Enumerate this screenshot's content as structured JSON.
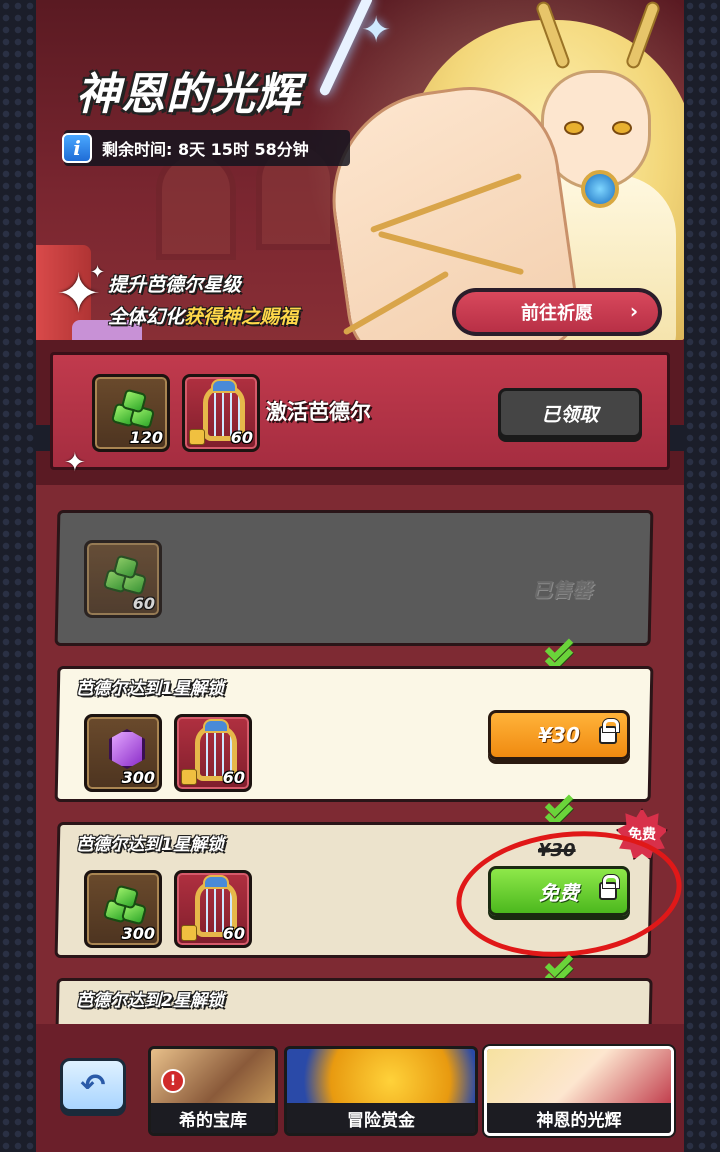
{
  "banner": {
    "title": "神恩的光辉",
    "timer": "剩余时间: 8天 15时 58分钟",
    "promo_line1": "提升芭德尔星级",
    "promo_line2_prefix": "全体幻化",
    "promo_line2_highlight": "获得神之赐福",
    "pray_button": "前往祈愿"
  },
  "activate": {
    "label": "激活芭德尔",
    "items": [
      {
        "icon": "green-gem-icon",
        "qty": "120"
      },
      {
        "icon": "harp-icon",
        "qty": "60"
      }
    ],
    "status_button": "已领取"
  },
  "tiers": [
    {
      "title": "",
      "items": [
        {
          "icon": "green-gem-icon",
          "qty": "60"
        }
      ],
      "status": "已售罄"
    },
    {
      "title": "芭德尔达到1星解锁",
      "items": [
        {
          "icon": "purple-gem-icon",
          "qty": "300"
        },
        {
          "icon": "harp-icon",
          "qty": "60"
        }
      ],
      "price": "¥30"
    },
    {
      "title": "芭德尔达到1星解锁",
      "items": [
        {
          "icon": "green-gem-icon",
          "qty": "300"
        },
        {
          "icon": "harp-icon",
          "qty": "60"
        }
      ],
      "old_price": "¥30",
      "badge": "免费",
      "button": "免费"
    },
    {
      "title": "芭德尔达到2星解锁"
    }
  ],
  "bottom_nav": {
    "tabs": [
      {
        "label": "希的宝库"
      },
      {
        "label": "冒险赏金"
      },
      {
        "label": "神恩的光辉",
        "active": true
      }
    ]
  },
  "colors": {
    "accent_red": "#c13a4d",
    "price_orange": "#f08a10",
    "free_green": "#4cb81e",
    "annotation_red": "#e01818"
  }
}
